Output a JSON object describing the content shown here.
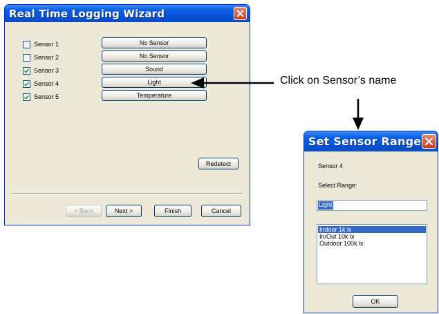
{
  "wizard": {
    "title": "Real Time Logging Wizard",
    "sensors": [
      {
        "label": "Sensor 1",
        "checked": false,
        "button": "No Sensor"
      },
      {
        "label": "Sensor 2",
        "checked": false,
        "button": "No Sensor"
      },
      {
        "label": "Sensor 3",
        "checked": true,
        "button": "Sound"
      },
      {
        "label": "Sensor 4",
        "checked": true,
        "button": "Light"
      },
      {
        "label": "Sensor 5",
        "checked": true,
        "button": "Temperature"
      }
    ],
    "redetect": "Redetect",
    "back": "< Back",
    "next": "Next >",
    "finish": "Finish",
    "cancel": "Cancel"
  },
  "callout": {
    "text": "Click on Sensor’s name"
  },
  "range_dialog": {
    "title": "Set Sensor Range",
    "sensor_name": "Sensor 4",
    "select_label": "Select Range:",
    "range_value": "Light",
    "options": [
      "Indoor  1k  lx",
      "In/Out  10k  lx",
      "Outdoor 100k lx"
    ],
    "selected_index": 0,
    "ok": "OK"
  },
  "colors": {
    "title_bar": "#0a5fe6",
    "dialog_bg": "#ece9d8",
    "selection": "#316ac5",
    "close_button": "#c9391d"
  }
}
